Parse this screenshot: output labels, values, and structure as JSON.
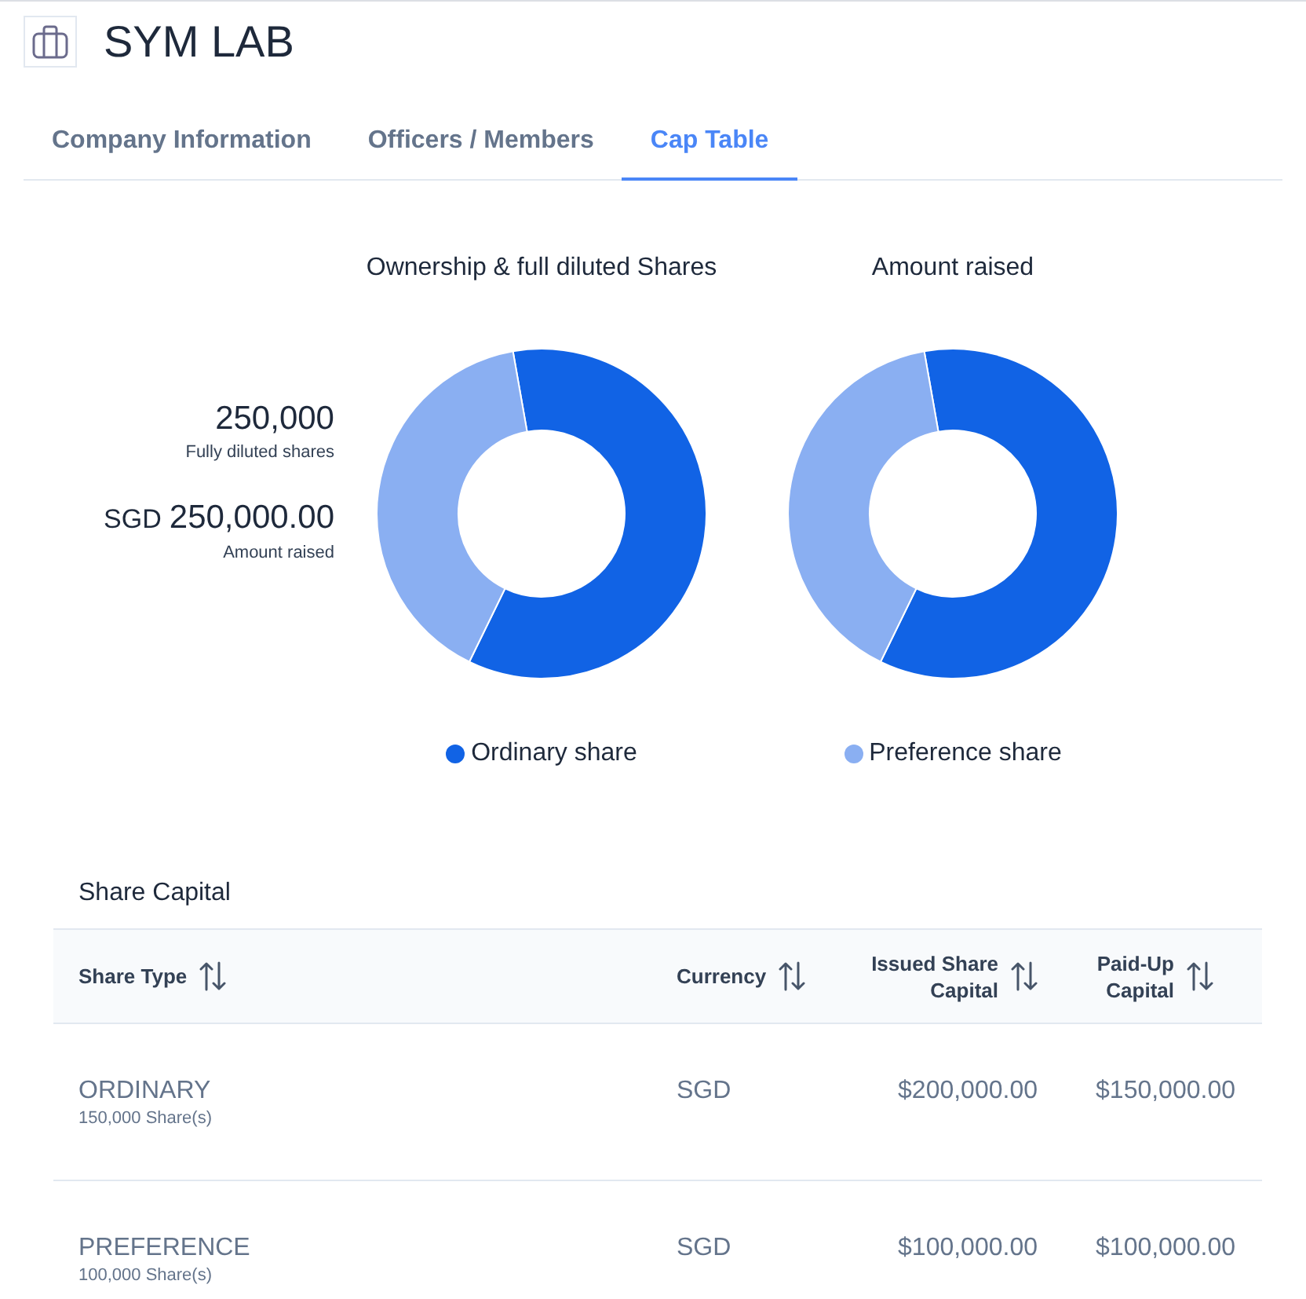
{
  "header": {
    "title": "SYM LAB"
  },
  "tabs": [
    {
      "label": "Company Information",
      "selected": false
    },
    {
      "label": "Officers / Members",
      "selected": false
    },
    {
      "label": "Cap Table",
      "selected": true
    }
  ],
  "summary": [
    {
      "value": "250,000",
      "caption": "Fully diluted shares"
    },
    {
      "unit": "SGD",
      "value": "250,000.00",
      "caption": "Amount raised"
    }
  ],
  "charts": [
    {
      "chart_data": {
        "type": "donut",
        "title": "Ownership & full diluted Shares",
        "values": [
          60,
          40
        ]
      }
    },
    {
      "chart_data": {
        "type": "donut",
        "title": "Amount raised",
        "values": [
          60,
          40
        ]
      }
    }
  ],
  "legend": [
    {
      "label": "Ordinary share",
      "color": "#1163e5"
    },
    {
      "label": "Preference share",
      "color": "#8aaff2"
    }
  ],
  "share_capital": {
    "title": "Share Capital",
    "columns": [
      "Share Type",
      "Currency",
      "Issued Share Capital",
      "Paid-Up Capital"
    ],
    "rows": [
      {
        "share_type": "ORDINARY",
        "shares": "150,000 Share(s)",
        "currency": "SGD",
        "issued_share_capital": "$200,000.00",
        "paid_up_capital": "$150,000.00"
      },
      {
        "share_type": "PREFERENCE",
        "shares": "100,000 Share(s)",
        "currency": "SGD",
        "issued_share_capital": "$100,000.00",
        "paid_up_capital": "$100,000.00"
      }
    ]
  }
}
